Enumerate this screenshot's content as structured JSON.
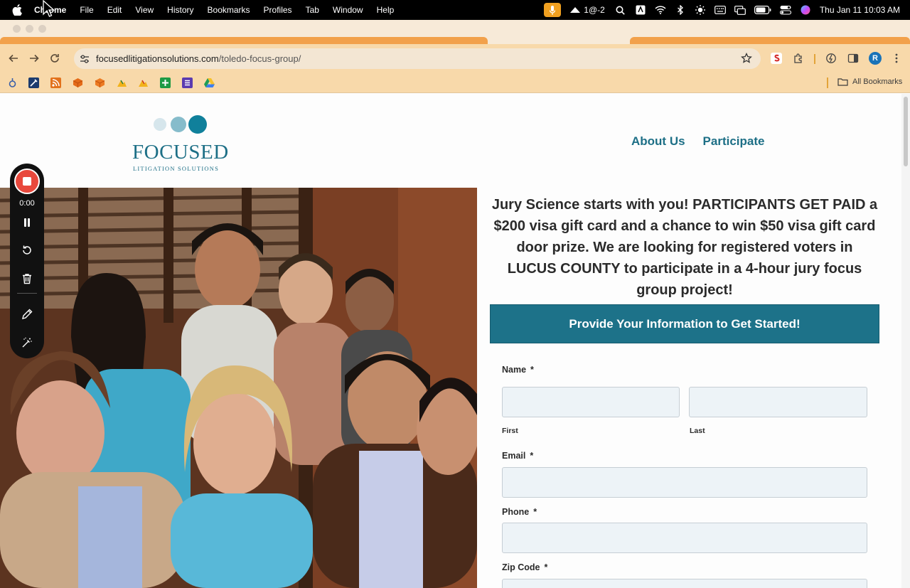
{
  "menubar": {
    "app": "Chrome",
    "items": [
      "File",
      "Edit",
      "View",
      "History",
      "Bookmarks",
      "Profiles",
      "Tab",
      "Window",
      "Help"
    ],
    "indicator": "1@-2",
    "clock": "Thu Jan 11  10:03 AM"
  },
  "browser": {
    "url_host": "focusedlitigationsolutions.com",
    "url_path": "/toledo-focus-group/",
    "profile_initial": "R",
    "all_bookmarks": "All Bookmarks"
  },
  "site": {
    "logo_name": "FOCUSED",
    "logo_tagline": "LITIGATION SOLUTIONS",
    "nav": [
      "About Us",
      "Participate"
    ],
    "headline": "Jury Science starts with you! PARTICIPANTS GET PAID a $200 visa gift card and a chance to win $50 visa gift card door prize. We are looking for registered voters in LUCUS COUNTY to participate in a 4-hour jury focus group project!",
    "cta": "Provide Your Information to Get Started!",
    "brand_color": "#1d7289"
  },
  "form": {
    "required_marker": "*",
    "name_label": "Name",
    "first_label": "First",
    "last_label": "Last",
    "email_label": "Email",
    "phone_label": "Phone",
    "zip_label": "Zip Code"
  },
  "recorder": {
    "timer": "0:00",
    "tools": [
      "stop-icon",
      "pause-icon",
      "restart-icon",
      "trash-icon",
      "pen-icon",
      "magic-wand-icon"
    ]
  }
}
